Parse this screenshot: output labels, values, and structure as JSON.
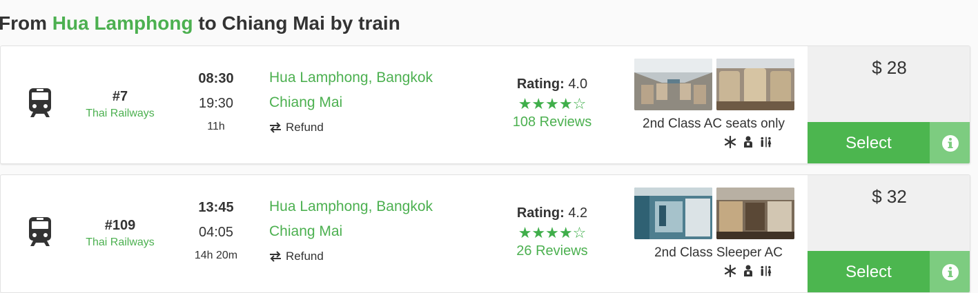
{
  "heading": {
    "prefix": "From ",
    "from": "Hua Lamphong",
    "middle": " to ",
    "to": "Chiang Mai",
    "suffix": " by train"
  },
  "colors": {
    "accent_green": "#4cb050",
    "select_green": "#4cb64f",
    "info_green": "#7dcc80",
    "star_green": "#3fae4a"
  },
  "trips": [
    {
      "icon": "train-icon",
      "number": "#7",
      "operator": "Thai Railways",
      "departure": "08:30",
      "arrival": "19:30",
      "duration": "11h",
      "from_station": "Hua Lamphong, Bangkok",
      "to_station": "Chiang Mai",
      "refund_label": "Refund",
      "rating_label": "Rating:",
      "rating_value": "4.0",
      "stars_filled": 4,
      "stars_total": 5,
      "stars_text": "★★★★☆",
      "reviews": "108 Reviews",
      "class_name": "2nd Class AC seats only",
      "amenities": [
        "snowflake-icon",
        "seat-person-icon",
        "restroom-icon"
      ],
      "price": "$ 28",
      "select_label": "Select",
      "info_icon": "info-icon"
    },
    {
      "icon": "train-icon",
      "number": "#109",
      "operator": "Thai Railways",
      "departure": "13:45",
      "arrival": "04:05",
      "duration": "14h 20m",
      "from_station": "Hua Lamphong, Bangkok",
      "to_station": "Chiang Mai",
      "refund_label": "Refund",
      "rating_label": "Rating:",
      "rating_value": "4.2",
      "stars_filled": 4,
      "stars_total": 5,
      "stars_text": "★★★★☆",
      "reviews": "26 Reviews",
      "class_name": "2nd Class Sleeper AC",
      "amenities": [
        "snowflake-icon",
        "seat-person-icon",
        "restroom-icon"
      ],
      "price": "$ 32",
      "select_label": "Select",
      "info_icon": "info-icon"
    }
  ]
}
